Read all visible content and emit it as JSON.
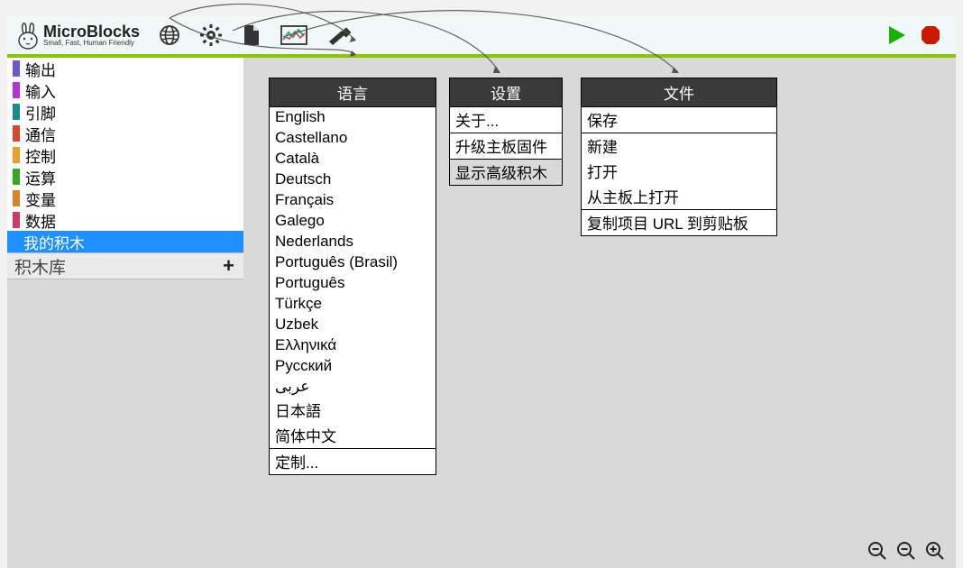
{
  "app": {
    "title": "MicroBlocks",
    "subtitle": "Small, Fast, Human Friendly"
  },
  "sidebar": {
    "categories": [
      {
        "label": "输出",
        "color": "#6a5acd"
      },
      {
        "label": "输入",
        "color": "#b333d4"
      },
      {
        "label": "引脚",
        "color": "#1b8a8a"
      },
      {
        "label": "通信",
        "color": "#d14b2a"
      },
      {
        "label": "控制",
        "color": "#e8a02a"
      },
      {
        "label": "运算",
        "color": "#3aa52a"
      },
      {
        "label": "变量",
        "color": "#d9842a"
      },
      {
        "label": "数据",
        "color": "#cc3a66"
      }
    ],
    "selected_label": "我的积木",
    "libraries_label": "积木库"
  },
  "menus": {
    "language": {
      "title": "语言",
      "items": [
        "English",
        "Castellano",
        "Català",
        "Deutsch",
        "Français",
        "Galego",
        "Nederlands",
        "Português (Brasil)",
        "Português",
        "Türkçe",
        "Uzbek",
        "Ελληνικά",
        "Русский",
        "عربى",
        "日本語",
        "简体中文"
      ],
      "custom": "定制..."
    },
    "settings": {
      "title": "设置",
      "about": "关于...",
      "upgrade": "升级主板固件",
      "advanced": "显示高级积木"
    },
    "file": {
      "title": "文件",
      "save": "保存",
      "new": "新建",
      "open": "打开",
      "open_board": "从主板上打开",
      "copy_url": "复制项目 URL 到剪贴板"
    }
  }
}
